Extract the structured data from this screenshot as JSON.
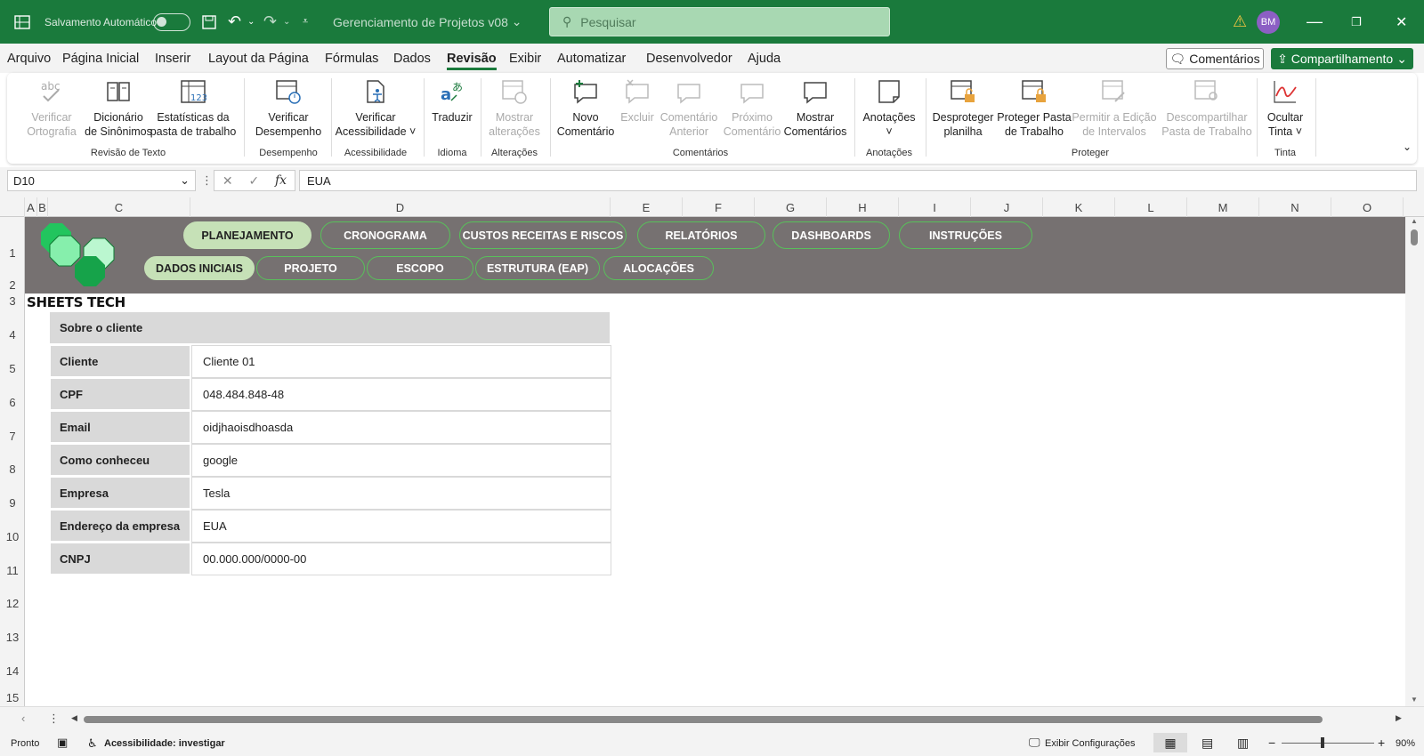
{
  "titlebar": {
    "autosave_label": "Salvamento Automático",
    "file_name": "Gerenciamento de Projetos v08",
    "search_placeholder": "Pesquisar",
    "user_initials": "BM"
  },
  "menu": {
    "items": [
      "Arquivo",
      "Página Inicial",
      "Inserir",
      "Layout da Página",
      "Fórmulas",
      "Dados",
      "Revisão",
      "Exibir",
      "Automatizar",
      "Desenvolvedor",
      "Ajuda"
    ],
    "active": "Revisão",
    "comments_button": "Comentários",
    "share_button": "Compartilhamento"
  },
  "ribbon": {
    "buttons": [
      {
        "label1": "Verificar",
        "label2": "Ortografia",
        "icon": "abc-check-icon",
        "disabled": true
      },
      {
        "label1": "Dicionário",
        "label2": "de Sinônimos",
        "icon": "book-icon",
        "disabled": false
      },
      {
        "label1": "Estatísticas da",
        "label2": "pasta de trabalho",
        "icon": "grid-123-icon",
        "disabled": false
      },
      {
        "label1": "Verificar",
        "label2": "Desempenho",
        "icon": "performance-icon",
        "disabled": false
      },
      {
        "label1": "Verificar",
        "label2": "Acessibilidade ˅",
        "icon": "accessibility-icon",
        "disabled": false
      },
      {
        "label1": "Traduzir",
        "label2": "",
        "icon": "translate-icon",
        "disabled": false
      },
      {
        "label1": "Mostrar",
        "label2": "alterações",
        "icon": "changes-icon",
        "disabled": true
      },
      {
        "label1": "Novo",
        "label2": "Comentário",
        "icon": "new-comment-icon",
        "disabled": false
      },
      {
        "label1": "Excluir",
        "label2": "",
        "icon": "delete-comment-icon",
        "disabled": true
      },
      {
        "label1": "Comentário",
        "label2": "Anterior",
        "icon": "previous-comment-icon",
        "disabled": true
      },
      {
        "label1": "Próximo",
        "label2": "Comentário",
        "icon": "next-comment-icon",
        "disabled": true
      },
      {
        "label1": "Mostrar",
        "label2": "Comentários",
        "icon": "show-comments-icon",
        "disabled": false
      },
      {
        "label1": "Anotações",
        "label2": "˅",
        "icon": "notes-icon",
        "disabled": false
      },
      {
        "label1": "Desproteger",
        "label2": "planilha",
        "icon": "unprotect-sheet-icon",
        "disabled": false
      },
      {
        "label1": "Proteger Pasta",
        "label2": "de Trabalho",
        "icon": "protect-workbook-icon",
        "disabled": false
      },
      {
        "label1": "Permitir a Edição",
        "label2": "de Intervalos",
        "icon": "allow-edit-ranges-icon",
        "disabled": true
      },
      {
        "label1": "Descompartilhar",
        "label2": "Pasta de Trabalho",
        "icon": "unshare-workbook-icon",
        "disabled": true
      },
      {
        "label1": "Ocultar",
        "label2": "Tinta ˅",
        "icon": "ink-icon",
        "disabled": false
      }
    ],
    "groups": [
      "Revisão de Texto",
      "Desempenho",
      "Acessibilidade",
      "Idioma",
      "Alterações",
      "Comentários",
      "Anotações",
      "Proteger",
      "Tinta"
    ]
  },
  "formula_bar": {
    "name_box": "D10",
    "fx": "fx",
    "value": "EUA"
  },
  "columns": [
    "A",
    "B",
    "C",
    "D",
    "E",
    "F",
    "G",
    "H",
    "I",
    "J",
    "K",
    "L",
    "M",
    "N",
    "O"
  ],
  "rows": [
    "1",
    "2",
    "3",
    "4",
    "5",
    "6",
    "7",
    "8",
    "9",
    "10",
    "11",
    "12",
    "13",
    "14",
    "15"
  ],
  "nav": {
    "top": [
      "PLANEJAMENTO",
      "CRONOGRAMA",
      "CUSTOS RECEITAS E RISCOS",
      "RELATÓRIOS",
      "DASHBOARDS",
      "INSTRUÇÕES"
    ],
    "bottom": [
      "DADOS INICIAIS",
      "PROJETO",
      "ESCOPO",
      "ESTRUTURA (EAP)",
      "ALOCAÇÕES"
    ],
    "active_top": "PLANEJAMENTO",
    "active_bottom": "DADOS INICIAIS"
  },
  "brand": "SHEETS TECH",
  "client_table": {
    "title": "Sobre o cliente",
    "rows": [
      {
        "key": "Cliente",
        "value": "Cliente 01"
      },
      {
        "key": "CPF",
        "value": "048.484.848-48"
      },
      {
        "key": "Email",
        "value": "oidjhaoisdhoasda"
      },
      {
        "key": "Como conheceu",
        "value": "google"
      },
      {
        "key": "Empresa",
        "value": "Tesla"
      },
      {
        "key": "Endereço da empresa",
        "value": "EUA"
      },
      {
        "key": "CNPJ",
        "value": "00.000.000/0000-00"
      }
    ]
  },
  "status": {
    "ready": "Pronto",
    "accessibility": "Acessibilidade: investigar",
    "display_settings": "Exibir Configurações",
    "zoom": "90%"
  },
  "colors": {
    "excel_green": "#1a7a3c",
    "banner_gray": "#767171",
    "pill_border": "#58c15a",
    "pill_active": "#c6e1b7"
  }
}
